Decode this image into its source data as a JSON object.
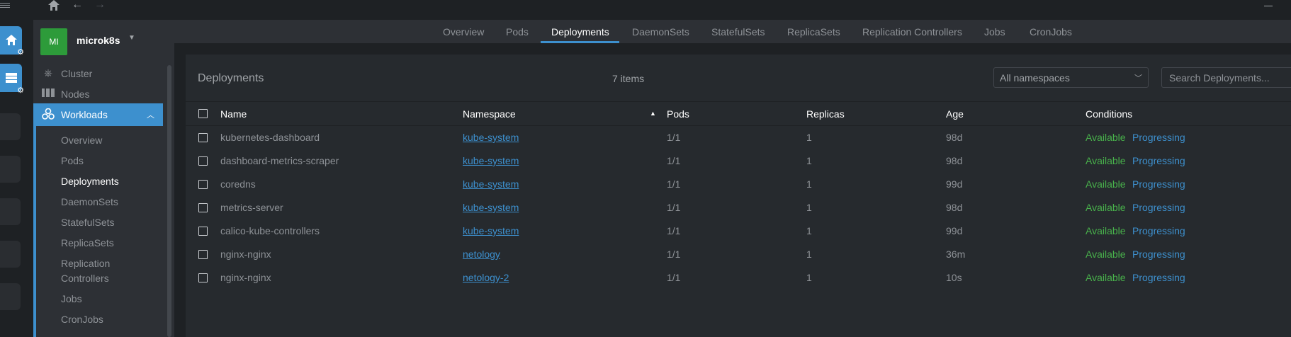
{
  "titlebar": {
    "menu_icon": "hamburger-icon",
    "home_icon": "home-icon",
    "back_icon": "arrow-left-icon",
    "forward_icon": "arrow-right-icon"
  },
  "cluster": {
    "avatar_initials": "MI",
    "name": "microk8s"
  },
  "sidebar": {
    "items": [
      {
        "label": "Cluster",
        "icon": "helm-icon"
      },
      {
        "label": "Nodes",
        "icon": "nodes-icon"
      },
      {
        "label": "Workloads",
        "icon": "workloads-icon"
      }
    ],
    "subitems": [
      "Overview",
      "Pods",
      "Deployments",
      "DaemonSets",
      "StatefulSets",
      "ReplicaSets",
      "Replication Controllers",
      "Jobs",
      "CronJobs"
    ]
  },
  "tabs": [
    "Overview",
    "Pods",
    "Deployments",
    "DaemonSets",
    "StatefulSets",
    "ReplicaSets",
    "Replication Controllers",
    "Jobs",
    "CronJobs"
  ],
  "panel": {
    "title": "Deployments",
    "count": "7 items",
    "namespace_filter": "All namespaces",
    "search_placeholder": "Search Deployments..."
  },
  "table": {
    "columns": [
      "Name",
      "Namespace",
      "Pods",
      "Replicas",
      "Age",
      "Conditions"
    ],
    "rows": [
      {
        "name": "kubernetes-dashboard",
        "namespace": "kube-system",
        "pods": "1/1",
        "replicas": "1",
        "age": "98d",
        "cond1": "Available",
        "cond2": "Progressing"
      },
      {
        "name": "dashboard-metrics-scraper",
        "namespace": "kube-system",
        "pods": "1/1",
        "replicas": "1",
        "age": "98d",
        "cond1": "Available",
        "cond2": "Progressing"
      },
      {
        "name": "coredns",
        "namespace": "kube-system",
        "pods": "1/1",
        "replicas": "1",
        "age": "99d",
        "cond1": "Available",
        "cond2": "Progressing"
      },
      {
        "name": "metrics-server",
        "namespace": "kube-system",
        "pods": "1/1",
        "replicas": "1",
        "age": "98d",
        "cond1": "Available",
        "cond2": "Progressing"
      },
      {
        "name": "calico-kube-controllers",
        "namespace": "kube-system",
        "pods": "1/1",
        "replicas": "1",
        "age": "99d",
        "cond1": "Available",
        "cond2": "Progressing"
      },
      {
        "name": "nginx-nginx",
        "namespace": "netology",
        "pods": "1/1",
        "replicas": "1",
        "age": "36m",
        "cond1": "Available",
        "cond2": "Progressing"
      },
      {
        "name": "nginx-nginx",
        "namespace": "netology-2",
        "pods": "1/1",
        "replicas": "1",
        "age": "10s",
        "cond1": "Available",
        "cond2": "Progressing"
      }
    ]
  },
  "colors": {
    "accent": "#3d90ce",
    "available": "#48b14b",
    "avatar": "#2d9b3a",
    "background": "#1e2124",
    "panel": "#262a2e"
  }
}
